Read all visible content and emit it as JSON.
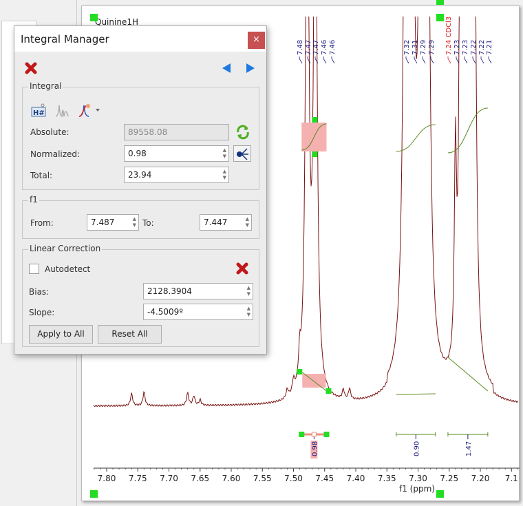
{
  "spectrum": {
    "title": "Quinine1H",
    "x_label": "f1 (ppm)",
    "x_ticks": [
      "7.80",
      "7.75",
      "7.70",
      "7.65",
      "7.60",
      "7.55",
      "7.50",
      "7.45",
      "7.40",
      "7.35",
      "7.30",
      "7.25",
      "7.20",
      "7.1"
    ],
    "peak_labels": [
      {
        "text": "7.48",
        "color": "#1a1a80"
      },
      {
        "text": "7.47",
        "color": "#1a1a80"
      },
      {
        "text": "7.47",
        "color": "#1a1a80"
      },
      {
        "text": "7.46",
        "color": "#1a1a80"
      },
      {
        "text": "7.46",
        "color": "#1a1a80"
      },
      {
        "text": "7.32",
        "color": "#1a1a80"
      },
      {
        "text": "7.31",
        "color": "#1a1a80"
      },
      {
        "text": "7.29",
        "color": "#1a1a80"
      },
      {
        "text": "7.29",
        "color": "#1a1a80"
      },
      {
        "text": "7.24 CDCl3",
        "color": "#e02020"
      },
      {
        "text": "7.23",
        "color": "#1a1a80"
      },
      {
        "text": "7.23",
        "color": "#1a1a80"
      },
      {
        "text": "7.22",
        "color": "#1a1a80"
      },
      {
        "text": "7.22",
        "color": "#1a1a80"
      },
      {
        "text": "7.21",
        "color": "#1a1a80"
      }
    ],
    "integrals": [
      {
        "value": "0.98",
        "from": 7.487,
        "to": 7.447,
        "selected": true
      },
      {
        "value": "0.90",
        "from": 7.335,
        "to": 7.272,
        "selected": false
      },
      {
        "value": "1.47",
        "from": 7.252,
        "to": 7.188,
        "selected": false
      }
    ],
    "colors": {
      "spectrum": "#7a1010",
      "integral": "#5a8a20",
      "handle": "#22dd22",
      "selection": "#f5b0b0"
    }
  },
  "dialog": {
    "title": "Integral Manager",
    "close": "×",
    "integral_group": "Integral",
    "absolute_label": "Absolute:",
    "absolute_value": "89558.08",
    "normalized_label": "Normalized:",
    "normalized_value": "0.98",
    "total_label": "Total:",
    "total_value": "23.94",
    "f1_group": "f1",
    "from_label": "From:",
    "from_value": "7.487",
    "to_label": "To:",
    "to_value": "7.447",
    "linear_group": "Linear Correction",
    "autodetect_label": "Autodetect",
    "autodetect_checked": false,
    "bias_label": "Bias:",
    "bias_value": "2128.3904",
    "slope_label": "Slope:",
    "slope_value": "-4.5009º",
    "apply_all": "Apply to All",
    "reset_all": "Reset All"
  }
}
